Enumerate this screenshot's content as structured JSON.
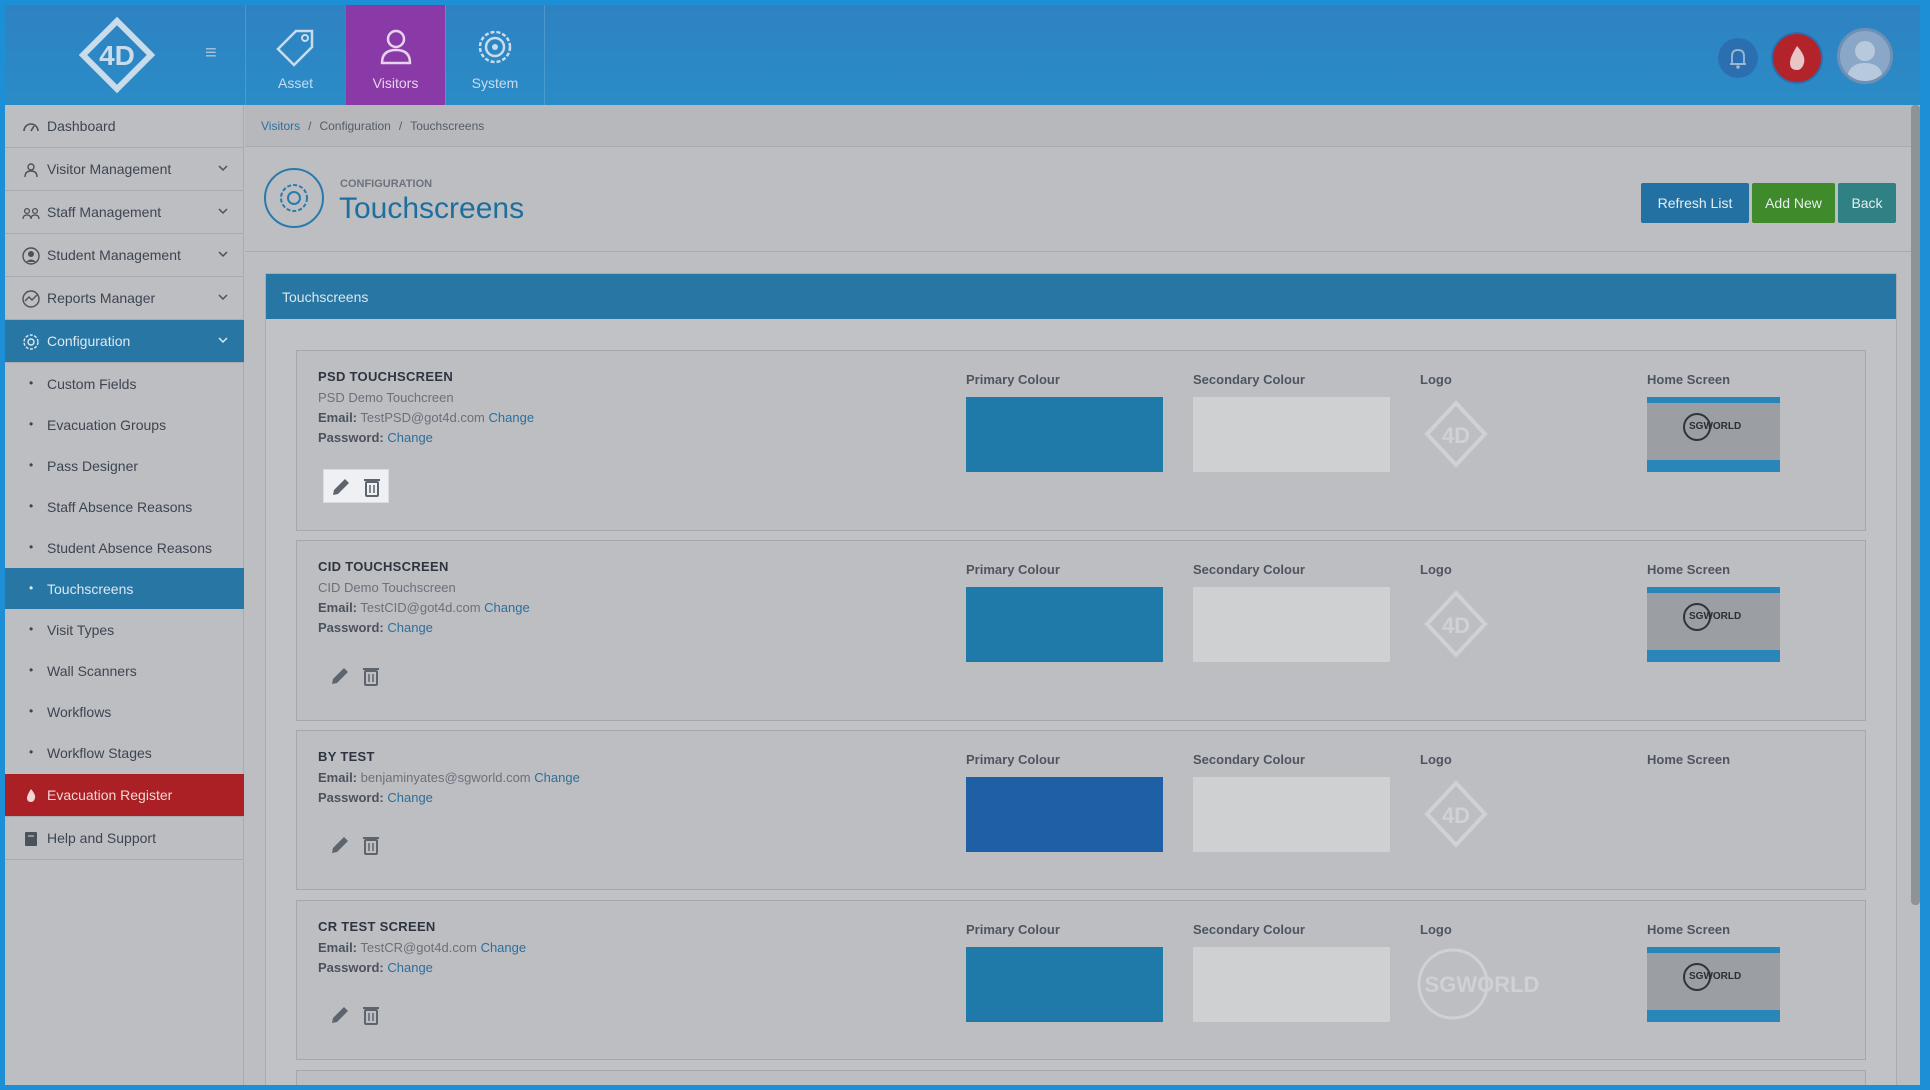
{
  "topbar": {
    "logo_text": "4D",
    "nav": [
      {
        "label": "Asset",
        "icon": "tag-icon",
        "active": false
      },
      {
        "label": "Visitors",
        "icon": "person-icon",
        "active": true
      },
      {
        "label": "System",
        "icon": "gear-icon",
        "active": false
      }
    ]
  },
  "sidebar": {
    "items": [
      {
        "label": "Dashboard",
        "icon": "dashboard-icon"
      },
      {
        "label": "Visitor Management",
        "icon": "person-icon"
      },
      {
        "label": "Staff Management",
        "icon": "staff-icon"
      },
      {
        "label": "Student Management",
        "icon": "student-icon"
      },
      {
        "label": "Reports Manager",
        "icon": "chart-icon"
      },
      {
        "label": "Configuration",
        "icon": "gear-icon"
      }
    ],
    "sub_items": [
      {
        "label": "Custom Fields"
      },
      {
        "label": "Evacuation Groups"
      },
      {
        "label": "Pass Designer"
      },
      {
        "label": "Staff Absence Reasons"
      },
      {
        "label": "Student Absence Reasons"
      },
      {
        "label": "Touchscreens"
      },
      {
        "label": "Visit Types"
      },
      {
        "label": "Wall Scanners"
      },
      {
        "label": "Workflows"
      },
      {
        "label": "Workflow Stages"
      }
    ],
    "evacuation": {
      "label": "Evacuation Register"
    },
    "help": {
      "label": "Help and Support"
    }
  },
  "breadcrumb": {
    "first": "Visitors",
    "second": "Configuration",
    "third": "Touchscreens"
  },
  "page": {
    "overline": "CONFIGURATION",
    "title": "Touchscreens"
  },
  "buttons": {
    "refresh": "Refresh List",
    "add": "Add New",
    "back": "Back"
  },
  "panel": {
    "title": "Touchscreens"
  },
  "labels": {
    "email": "Email:",
    "password": "Password:",
    "change": "Change",
    "primary": "Primary Colour",
    "secondary": "Secondary Colour",
    "logo": "Logo",
    "home": "Home Screen"
  },
  "touchscreens": [
    {
      "name": "PSD TOUCHSCREEN",
      "description": "PSD Demo Touchcreen",
      "email": "TestPSD@got4d.com",
      "primary_colour": "#1f79a9",
      "secondary_colour": "#cfd0d2",
      "logo": "4D",
      "home_screen": "SGWORLD"
    },
    {
      "name": "CID TOUCHSCREEN",
      "description": "CID Demo Touchscreen",
      "email": "TestCID@got4d.com",
      "primary_colour": "#1f79a9",
      "secondary_colour": "#cfd0d2",
      "logo": "4D",
      "home_screen": "SGWORLD"
    },
    {
      "name": "BY TEST",
      "description": "",
      "email": "benjaminyates@sgworld.com",
      "primary_colour": "#1e5fa5",
      "secondary_colour": "#cfd0d2",
      "logo": "4D",
      "home_screen": ""
    },
    {
      "name": "CR TEST SCREEN",
      "description": "",
      "email": "TestCR@got4d.com",
      "primary_colour": "#1f79a9",
      "secondary_colour": "#cfd0d2",
      "logo": "SGWORLD",
      "home_screen": "SGWORLD"
    }
  ]
}
